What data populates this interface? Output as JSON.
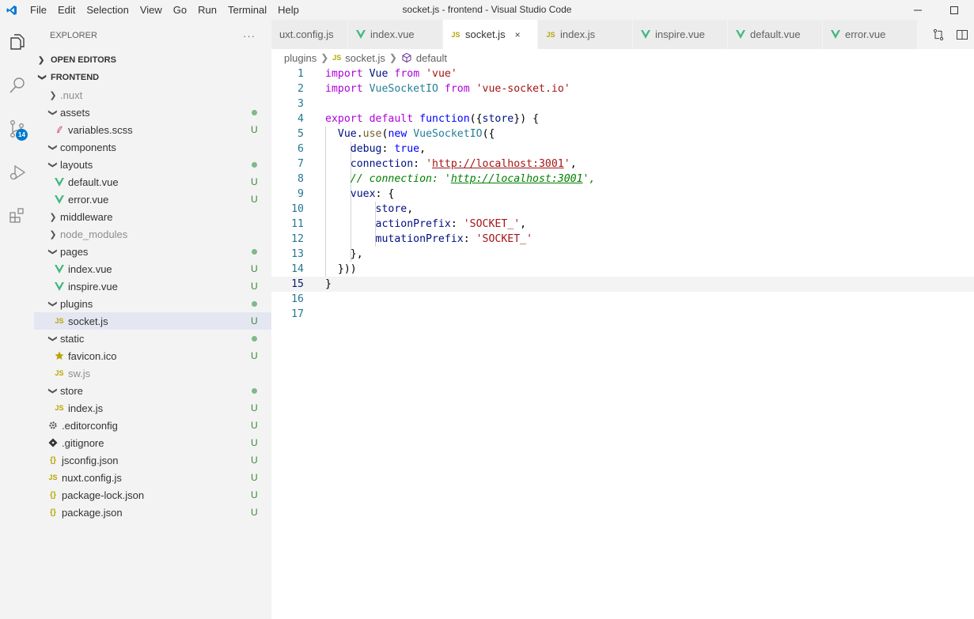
{
  "app": {
    "window_title": "socket.js - frontend - Visual Studio Code",
    "menu": [
      "File",
      "Edit",
      "Selection",
      "View",
      "Go",
      "Run",
      "Terminal",
      "Help"
    ]
  },
  "activity_bar": {
    "items": [
      {
        "name": "explorer-icon",
        "label": "Explorer"
      },
      {
        "name": "search-icon",
        "label": "Search"
      },
      {
        "name": "source-control-icon",
        "label": "Source Control",
        "badge": "14"
      },
      {
        "name": "run-debug-icon",
        "label": "Run and Debug"
      },
      {
        "name": "extensions-icon",
        "label": "Extensions"
      }
    ]
  },
  "explorer": {
    "title": "EXPLORER",
    "more": "···",
    "open_editors": "OPEN EDITORS",
    "project": "FRONTEND",
    "rows": [
      {
        "depth": 1,
        "type": "folder",
        "open": false,
        "name": ".nuxt",
        "dim": true
      },
      {
        "depth": 1,
        "type": "folder",
        "open": true,
        "name": "assets",
        "dot": true
      },
      {
        "depth": 2,
        "type": "scss",
        "name": "variables.scss",
        "status": "U"
      },
      {
        "depth": 1,
        "type": "folder",
        "open": true,
        "name": "components"
      },
      {
        "depth": 1,
        "type": "folder",
        "open": true,
        "name": "layouts",
        "dot": true
      },
      {
        "depth": 2,
        "type": "vue",
        "name": "default.vue",
        "status": "U"
      },
      {
        "depth": 2,
        "type": "vue",
        "name": "error.vue",
        "status": "U"
      },
      {
        "depth": 1,
        "type": "folder",
        "open": false,
        "name": "middleware"
      },
      {
        "depth": 1,
        "type": "folder",
        "open": false,
        "name": "node_modules",
        "dim": true
      },
      {
        "depth": 1,
        "type": "folder",
        "open": true,
        "name": "pages",
        "dot": true
      },
      {
        "depth": 2,
        "type": "vue",
        "name": "index.vue",
        "status": "U"
      },
      {
        "depth": 2,
        "type": "vue",
        "name": "inspire.vue",
        "status": "U"
      },
      {
        "depth": 1,
        "type": "folder",
        "open": true,
        "name": "plugins",
        "dot": true
      },
      {
        "depth": 2,
        "type": "js",
        "name": "socket.js",
        "status": "U",
        "selected": true
      },
      {
        "depth": 1,
        "type": "folder",
        "open": true,
        "name": "static",
        "dot": true
      },
      {
        "depth": 2,
        "type": "star",
        "name": "favicon.ico",
        "status": "U"
      },
      {
        "depth": 2,
        "type": "js",
        "name": "sw.js",
        "dim": true
      },
      {
        "depth": 1,
        "type": "folder",
        "open": true,
        "name": "store",
        "dot": true
      },
      {
        "depth": 2,
        "type": "js",
        "name": "index.js",
        "status": "U"
      },
      {
        "depth": 1,
        "type": "gear",
        "name": ".editorconfig",
        "status": "U"
      },
      {
        "depth": 1,
        "type": "git",
        "name": ".gitignore",
        "status": "U"
      },
      {
        "depth": 1,
        "type": "json",
        "name": "jsconfig.json",
        "status": "U"
      },
      {
        "depth": 1,
        "type": "js",
        "name": "nuxt.config.js",
        "status": "U"
      },
      {
        "depth": 1,
        "type": "json",
        "name": "package-lock.json",
        "status": "U"
      },
      {
        "depth": 1,
        "type": "json",
        "name": "package.json",
        "status": "U"
      }
    ]
  },
  "tabs": [
    {
      "type": "none",
      "label": "uxt.config.js",
      "width": 97
    },
    {
      "type": "vue",
      "label": "index.vue",
      "width": 120
    },
    {
      "type": "js",
      "label": "socket.js",
      "width": 120,
      "active": true,
      "close": "×"
    },
    {
      "type": "js",
      "label": "index.js",
      "width": 120
    },
    {
      "type": "vue",
      "label": "inspire.vue",
      "width": 120
    },
    {
      "type": "vue",
      "label": "default.vue",
      "width": 120
    },
    {
      "type": "vue",
      "label": "error.vue",
      "width": 120
    }
  ],
  "breadcrumb": {
    "folder": "plugins",
    "file": "socket.js",
    "symbol": "default"
  },
  "editor": {
    "current_line": 15,
    "lines": [
      {
        "n": "1",
        "tokens": [
          [
            "kw2",
            "import"
          ],
          [
            "",
            " "
          ],
          [
            "tok",
            "Vue"
          ],
          [
            "",
            " "
          ],
          [
            "kw2",
            "from"
          ],
          [
            "",
            " "
          ],
          [
            "str",
            "'vue'"
          ]
        ]
      },
      {
        "n": "2",
        "tokens": [
          [
            "kw2",
            "import"
          ],
          [
            "",
            " "
          ],
          [
            "ty",
            "VueSocketIO"
          ],
          [
            "",
            " "
          ],
          [
            "kw2",
            "from"
          ],
          [
            "",
            " "
          ],
          [
            "str",
            "'vue-socket.io'"
          ]
        ]
      },
      {
        "n": "3",
        "tokens": []
      },
      {
        "n": "4",
        "tokens": [
          [
            "kw2",
            "export"
          ],
          [
            "",
            " "
          ],
          [
            "kw2",
            "default"
          ],
          [
            "",
            " "
          ],
          [
            "kw",
            "function"
          ],
          [
            "",
            "({"
          ],
          [
            "tok",
            "store"
          ],
          [
            "",
            "}) {"
          ]
        ]
      },
      {
        "n": "5",
        "guides": [
          1
        ],
        "tokens": [
          [
            "",
            "  "
          ],
          [
            "tok",
            "Vue"
          ],
          [
            "",
            "."
          ],
          [
            "fn",
            "use"
          ],
          [
            "",
            "("
          ],
          [
            "kw",
            "new"
          ],
          [
            "",
            " "
          ],
          [
            "ty",
            "VueSocketIO"
          ],
          [
            "",
            "({"
          ]
        ]
      },
      {
        "n": "6",
        "guides": [
          1,
          2
        ],
        "tokens": [
          [
            "",
            "    "
          ],
          [
            "tok",
            "debug"
          ],
          [
            "",
            ": "
          ],
          [
            "kw",
            "true"
          ],
          [
            "",
            ","
          ]
        ]
      },
      {
        "n": "7",
        "guides": [
          1,
          2
        ],
        "tokens": [
          [
            "",
            "    "
          ],
          [
            "tok",
            "connection"
          ],
          [
            "",
            ": "
          ],
          [
            "str",
            "'"
          ],
          [
            "str url",
            "http://localhost:3001"
          ],
          [
            "str",
            "'"
          ],
          [
            "",
            ","
          ]
        ]
      },
      {
        "n": "8",
        "guides": [
          1,
          2
        ],
        "tokens": [
          [
            "",
            "    "
          ],
          [
            "cm",
            "// connection: '"
          ],
          [
            "cm url",
            "http://localhost:3001"
          ],
          [
            "cm",
            "',"
          ]
        ]
      },
      {
        "n": "9",
        "guides": [
          1,
          2
        ],
        "tokens": [
          [
            "",
            "    "
          ],
          [
            "tok",
            "vuex"
          ],
          [
            "",
            ": {"
          ]
        ]
      },
      {
        "n": "10",
        "guides": [
          1,
          2,
          3
        ],
        "tokens": [
          [
            "",
            "        "
          ],
          [
            "tok",
            "store"
          ],
          [
            "",
            ","
          ]
        ]
      },
      {
        "n": "11",
        "guides": [
          1,
          2,
          3
        ],
        "tokens": [
          [
            "",
            "        "
          ],
          [
            "tok",
            "actionPrefix"
          ],
          [
            "",
            ": "
          ],
          [
            "str",
            "'SOCKET_'"
          ],
          [
            "",
            ","
          ]
        ]
      },
      {
        "n": "12",
        "guides": [
          1,
          2,
          3
        ],
        "tokens": [
          [
            "",
            "        "
          ],
          [
            "tok",
            "mutationPrefix"
          ],
          [
            "",
            ": "
          ],
          [
            "str",
            "'SOCKET_'"
          ]
        ]
      },
      {
        "n": "13",
        "guides": [
          1,
          2
        ],
        "tokens": [
          [
            "",
            "    },"
          ]
        ]
      },
      {
        "n": "14",
        "guides": [
          1
        ],
        "tokens": [
          [
            "",
            "  }))"
          ]
        ]
      },
      {
        "n": "15",
        "tokens": [
          [
            "",
            "}"
          ]
        ]
      },
      {
        "n": "16",
        "tokens": []
      },
      {
        "n": "17",
        "tokens": []
      }
    ]
  },
  "colors": {
    "accent": "#007acc",
    "vue": "#41b883",
    "js": "#b8a600",
    "untracked": "#388a34"
  }
}
